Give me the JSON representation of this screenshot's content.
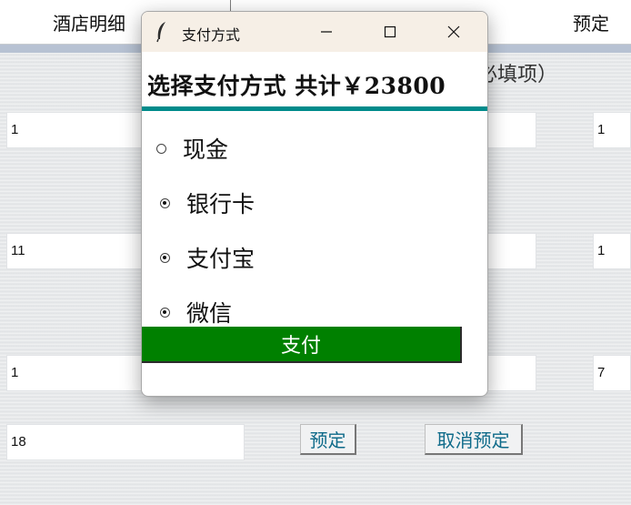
{
  "background": {
    "header": {
      "col1": "酒店明细",
      "col3": "预定"
    },
    "required_note": "必填项）",
    "fields": {
      "left": [
        "1",
        "11",
        "1",
        "18"
      ],
      "right": [
        "1",
        "1",
        "7"
      ]
    },
    "buttons": {
      "book": "预定",
      "cancel_book": "取消预定"
    }
  },
  "dialog": {
    "window_title": "支付方式",
    "heading": "选择支付方式  共计￥23800",
    "options": [
      {
        "label": "现金",
        "selected": false
      },
      {
        "label": "银行卡",
        "selected": true
      },
      {
        "label": "支付宝",
        "selected": true
      },
      {
        "label": "微信",
        "selected": true
      }
    ],
    "pay_button": "支付",
    "colors": {
      "accent_line": "#008b8b",
      "pay_button": "#008000",
      "titlebar": "#f6efe6"
    }
  }
}
